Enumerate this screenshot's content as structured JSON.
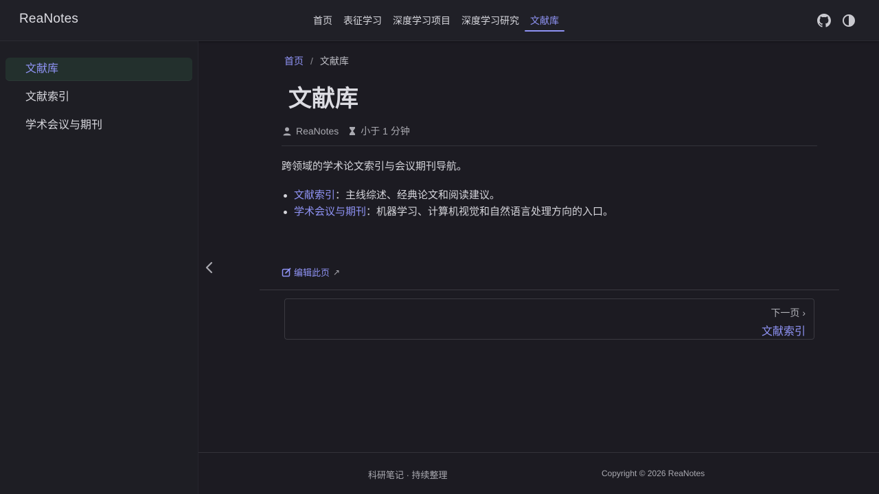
{
  "header": {
    "brand": "ReaNotes",
    "nav": [
      {
        "label": "首页"
      },
      {
        "label": "表征学习"
      },
      {
        "label": "深度学习项目"
      },
      {
        "label": "深度学习研究"
      },
      {
        "label": "文献库",
        "active": true
      }
    ],
    "icons": [
      "github-icon",
      "theme-toggle-icon"
    ]
  },
  "sidebar": {
    "items": [
      {
        "label": "文献库",
        "active": true
      },
      {
        "label": "文献索引"
      },
      {
        "label": "学术会议与期刊"
      }
    ]
  },
  "breadcrumb": {
    "home": "首页",
    "separator": "/",
    "current": "文献库"
  },
  "page": {
    "title": "文献库",
    "author": "ReaNotes",
    "reading_time": "小于 1 分钟",
    "intro": "跨领域的学术论文索引与会议期刊导航。",
    "list": [
      {
        "link": "文献索引",
        "text": "：主线综述、经典论文和阅读建议。"
      },
      {
        "link": "学术会议与期刊",
        "text": "：机器学习、计算机视觉和自然语言处理方向的入口。"
      }
    ],
    "edit_link": "编辑此页",
    "next": {
      "label": "下一页 ›",
      "title": "文献索引"
    }
  },
  "footer": {
    "left": "科研笔记 · 持续整理",
    "right": "Copyright © 2026 ReaNotes"
  },
  "colors": {
    "accent": "#8f93f5",
    "background": "#1c1b22",
    "header_bg": "#202027",
    "sidebar_active_bg": "#23302d"
  }
}
